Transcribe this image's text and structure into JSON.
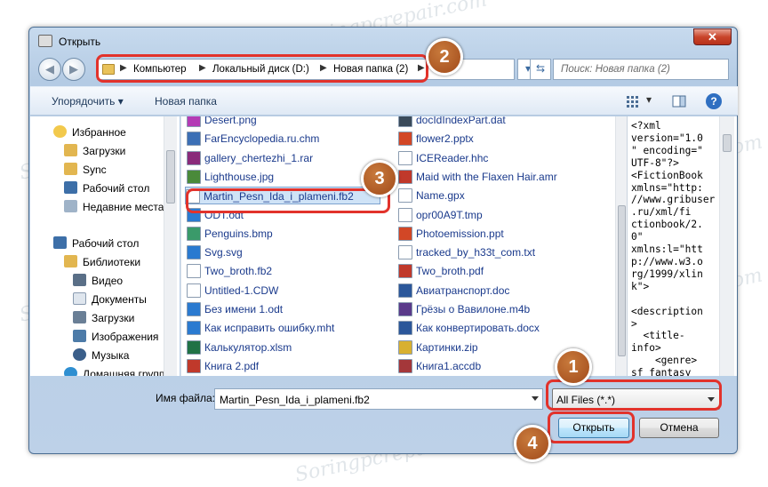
{
  "window": {
    "title": "Открыть",
    "close_glyph": "✕"
  },
  "address": {
    "crumbs": [
      "Компьютер",
      "Локальный диск (D:)",
      "Новая папка (2)"
    ],
    "search_placeholder": "Поиск: Новая папка (2)"
  },
  "toolbar": {
    "organize": "Упорядочить ▾",
    "new_folder": "Новая папка",
    "help": "?"
  },
  "nav": {
    "items": [
      {
        "label": "Избранное",
        "icon": "star-icon"
      },
      {
        "label": "Загрузки",
        "icon": "downloads-icon"
      },
      {
        "label": "Sync",
        "icon": "folder-icon"
      },
      {
        "label": "Рабочий стол",
        "icon": "desktop-icon"
      },
      {
        "label": "Недавние места",
        "icon": "recent-icon"
      },
      {
        "label": "Рабочий стол",
        "icon": "desktop-icon"
      },
      {
        "label": "Библиотеки",
        "icon": "libraries-icon"
      },
      {
        "label": "Видео",
        "icon": "video-icon"
      },
      {
        "label": "Документы",
        "icon": "documents-icon"
      },
      {
        "label": "Загрузки",
        "icon": "downloads-icon"
      },
      {
        "label": "Изображения",
        "icon": "pictures-icon"
      },
      {
        "label": "Музыка",
        "icon": "music-icon"
      },
      {
        "label": "Домашняя групп",
        "icon": "homegroup-icon"
      }
    ]
  },
  "files": {
    "col1": [
      {
        "label": "Desert.png",
        "icon": "png-icon"
      },
      {
        "label": "FarEncyclopedia.ru.chm",
        "icon": "chm-icon"
      },
      {
        "label": "gallery_chertezhi_1.rar",
        "icon": "rar-icon"
      },
      {
        "label": "Lighthouse.jpg",
        "icon": "jpg-icon"
      },
      {
        "label": "Martin_Pesn_Ida_i_plameni.fb2",
        "icon": "file-icon"
      },
      {
        "label": "ODT.odt",
        "icon": "odt-icon"
      },
      {
        "label": "Penguins.bmp",
        "icon": "bmp-icon"
      },
      {
        "label": "Svg.svg",
        "icon": "svg-icon"
      },
      {
        "label": "Two_broth.fb2",
        "icon": "file-icon"
      },
      {
        "label": "Untitled-1.CDW",
        "icon": "file-icon"
      },
      {
        "label": "Без имени 1.odt",
        "icon": "odt-icon"
      },
      {
        "label": "Как исправить ошибку.mht",
        "icon": "mht-icon"
      },
      {
        "label": "Калькулятор.xlsm",
        "icon": "xlsm-icon"
      },
      {
        "label": "Книга 2.pdf",
        "icon": "pdf-icon"
      }
    ],
    "col2": [
      {
        "label": "docIdIndexPart.dat",
        "icon": "dat-icon"
      },
      {
        "label": "flower2.pptx",
        "icon": "pptx-icon"
      },
      {
        "label": "ICEReader.hhc",
        "icon": "hhc-icon"
      },
      {
        "label": "Maid with the Flaxen Hair.amr",
        "icon": "amr-icon"
      },
      {
        "label": "Name.gpx",
        "icon": "file-icon"
      },
      {
        "label": "opr00A9T.tmp",
        "icon": "file-icon"
      },
      {
        "label": "Photoemission.ppt",
        "icon": "ppt-icon"
      },
      {
        "label": "tracked_by_h33t_com.txt",
        "icon": "txt-icon"
      },
      {
        "label": "Two_broth.pdf",
        "icon": "pdf-icon"
      },
      {
        "label": "Авиатранспорт.doc",
        "icon": "doc-icon"
      },
      {
        "label": "Грёзы о Вавилоне.m4b",
        "icon": "m4b-icon"
      },
      {
        "label": "Как конвертировать.docx",
        "icon": "docx-icon"
      },
      {
        "label": "Картинки.zip",
        "icon": "zip-icon"
      },
      {
        "label": "Книга1.accdb",
        "icon": "accdb-icon"
      }
    ],
    "selected": "Martin_Pesn_Ida_i_plameni.fb2"
  },
  "preview": {
    "text": "<?xml\nversion=\"1.0\n\" encoding=\"\nUTF-8\"?>\n<FictionBook\nxmlns=\"http:\n//www.gribuser\n.ru/xml/fi\nctionbook/2.\n0\"\nxmlns:l=\"htt\np://www.w3.o\nrg/1999/xlin\nk\">\n\n<description\n>\n  <title-\ninfo>\n    <genre>\nsf_fantasy\n</genre>\n    <genre>"
  },
  "bottom": {
    "filename_label": "Имя файла:",
    "filename_value": "Martin_Pesn_Ida_i_plameni.fb2",
    "filetype_value": "All Files (*.*)",
    "open_label": "Открыть",
    "cancel_label": "Отмена"
  },
  "callouts": [
    "1",
    "2",
    "3",
    "4"
  ],
  "watermark": "Soringpcrepair.com",
  "colors": {
    "callout": "#e2322b",
    "badge": "#a14a1a",
    "selection": "#cfe3f7"
  }
}
